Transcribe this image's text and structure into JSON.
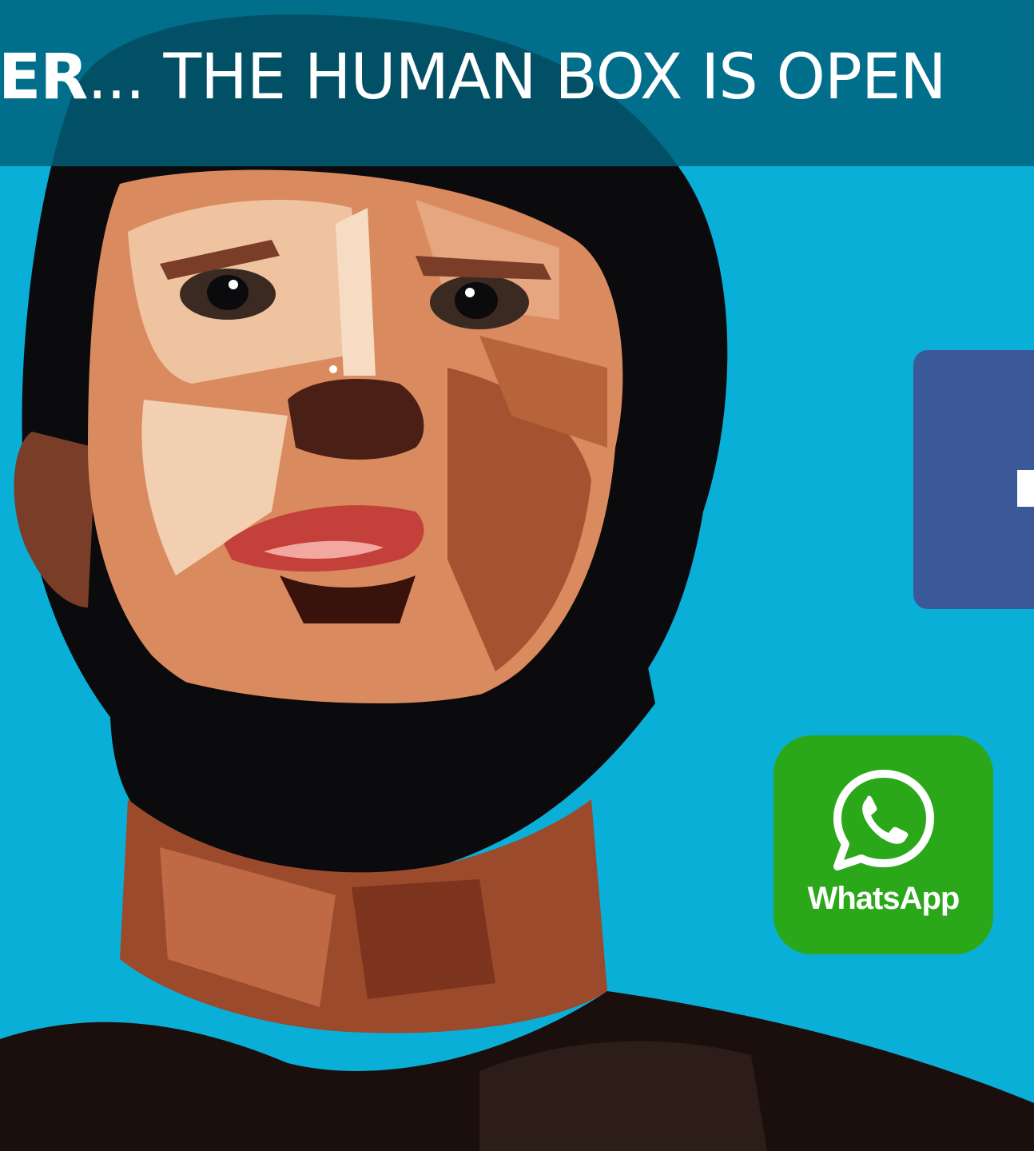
{
  "slide": {
    "title_bold": "ER",
    "title_rest": "... THE HUMAN BOX IS OPEN"
  },
  "icons": {
    "facebook": {
      "name": "facebook-icon",
      "color": "#3b5998"
    },
    "whatsapp": {
      "name": "whatsapp-icon",
      "label": "WhatsApp",
      "color": "#2aa81a"
    }
  },
  "colors": {
    "background": "#0aafd8",
    "title_bar": "#00607a",
    "title_text": "#ffffff"
  }
}
